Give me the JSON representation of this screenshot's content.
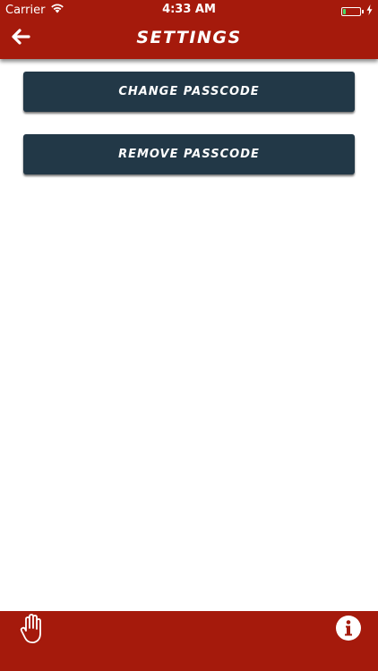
{
  "status_bar": {
    "carrier": "Carrier",
    "time": "4:33 AM",
    "battery_level": 0.15,
    "charging": true
  },
  "nav": {
    "title": "SETTINGS",
    "back_icon": "arrow-left-icon"
  },
  "buttons": {
    "change_passcode": "CHANGE PASSCODE",
    "remove_passcode": "REMOVE PASSCODE"
  },
  "footer": {
    "left_icon": "hand-icon",
    "right_icon": "info-icon"
  },
  "colors": {
    "header_red": "#a51a0c",
    "button_navy": "#223847",
    "battery_green": "#4cd964",
    "white": "#ffffff"
  }
}
